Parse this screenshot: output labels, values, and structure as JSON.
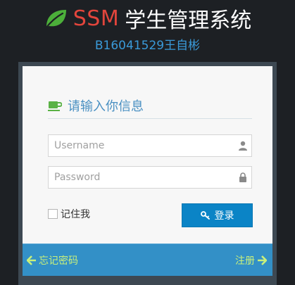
{
  "header": {
    "title_brand": "SSM",
    "title_rest": "学生管理系统",
    "subtitle": "B16041529王自彬"
  },
  "login": {
    "heading": "请输入你信息",
    "username_placeholder": "Username",
    "password_placeholder": "Password",
    "remember_label": "记住我",
    "login_label": "登录"
  },
  "footer": {
    "forgot_label": "忘记密码",
    "register_label": "注册"
  },
  "colors": {
    "brand_red": "#e2453c",
    "accent_blue": "#0b84c6",
    "footer_blue": "#3390c7",
    "link_green": "#c9f07b",
    "leaf_green": "#4caf3a"
  },
  "icons": [
    "leaf-icon",
    "coffee-cup-icon",
    "user-icon",
    "lock-icon",
    "key-icon",
    "arrow-left-icon",
    "arrow-right-icon"
  ]
}
